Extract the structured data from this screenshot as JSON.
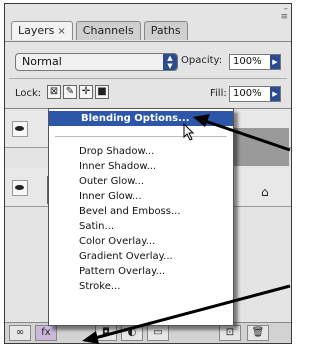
{
  "panel": {
    "tabs": [
      {
        "label": "Layers",
        "close": "×"
      },
      {
        "label": "Channels"
      },
      {
        "label": "Paths"
      }
    ],
    "window_controls": "–",
    "menu_glyph": "≡"
  },
  "blend_mode": {
    "value": "Normal"
  },
  "opacity": {
    "label": "Opacity:",
    "value": "100%"
  },
  "lock": {
    "label": "Lock:"
  },
  "fill": {
    "label": "Fill:",
    "value": "100%"
  },
  "fx_menu": {
    "items": [
      "Blending Options...",
      "Drop Shadow...",
      "Inner Shadow...",
      "Outer Glow...",
      "Inner Glow...",
      "Bevel and Emboss...",
      "Satin...",
      "Color Overlay...",
      "Gradient Overlay...",
      "Pattern Overlay...",
      "Stroke..."
    ],
    "highlighted_index": 0
  },
  "bottom_buttons": [
    "link-layers",
    "fx",
    "mask",
    "adjustment",
    "group",
    "new-layer",
    "delete"
  ],
  "colors": {
    "highlight": "#2c56a8",
    "arrow": "#000000"
  }
}
